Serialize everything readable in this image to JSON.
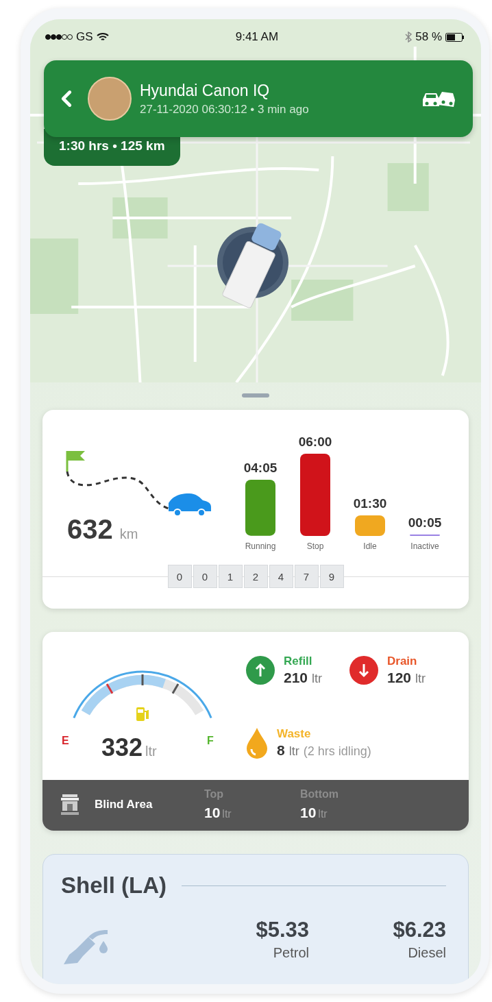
{
  "status_bar": {
    "carrier": "GS",
    "time": "9:41 AM",
    "battery": "58 %"
  },
  "vehicle": {
    "name": "Hyundai Canon IQ",
    "subtitle": "27-11-2020 06:30:12 • 3 min ago",
    "trip_summary": "1:30 hrs • 125 km"
  },
  "distance": {
    "value": "632",
    "unit": "km"
  },
  "activity": {
    "chart_data": {
      "type": "bar",
      "categories": [
        "Running",
        "Stop",
        "Idle",
        "Inactive"
      ],
      "value_labels": [
        "04:05",
        "06:00",
        "01:30",
        "00:05"
      ],
      "colors": [
        "#4a9a1c",
        "#d0131a",
        "#f0a820",
        "#8b6fe0"
      ],
      "values": [
        4.083,
        6,
        1.5,
        0.083
      ]
    }
  },
  "odometer": [
    "0",
    "0",
    "1",
    "2",
    "4",
    "7",
    "9"
  ],
  "fuel": {
    "level": 0.66,
    "empty_label": "E",
    "full_label": "F",
    "value": "332",
    "unit": "ltr",
    "events": [
      {
        "kind": "refill",
        "label": "Refill",
        "value": "210",
        "unit": "ltr"
      },
      {
        "kind": "drain",
        "label": "Drain",
        "value": "120",
        "unit": "ltr"
      },
      {
        "kind": "waste",
        "label": "Waste",
        "value": "8",
        "unit": "ltr",
        "note": "(2 hrs idling)"
      }
    ]
  },
  "blind_area": {
    "label": "Blind Area",
    "readings": [
      {
        "label": "Top",
        "value": "10",
        "unit": "ltr"
      },
      {
        "label": "Bottom",
        "value": "10",
        "unit": "ltr"
      }
    ]
  },
  "station": {
    "name": "Shell (LA)",
    "prices": [
      {
        "price": "$5.33",
        "fuel": "Petrol"
      },
      {
        "price": "$6.23",
        "fuel": "Diesel"
      }
    ]
  }
}
